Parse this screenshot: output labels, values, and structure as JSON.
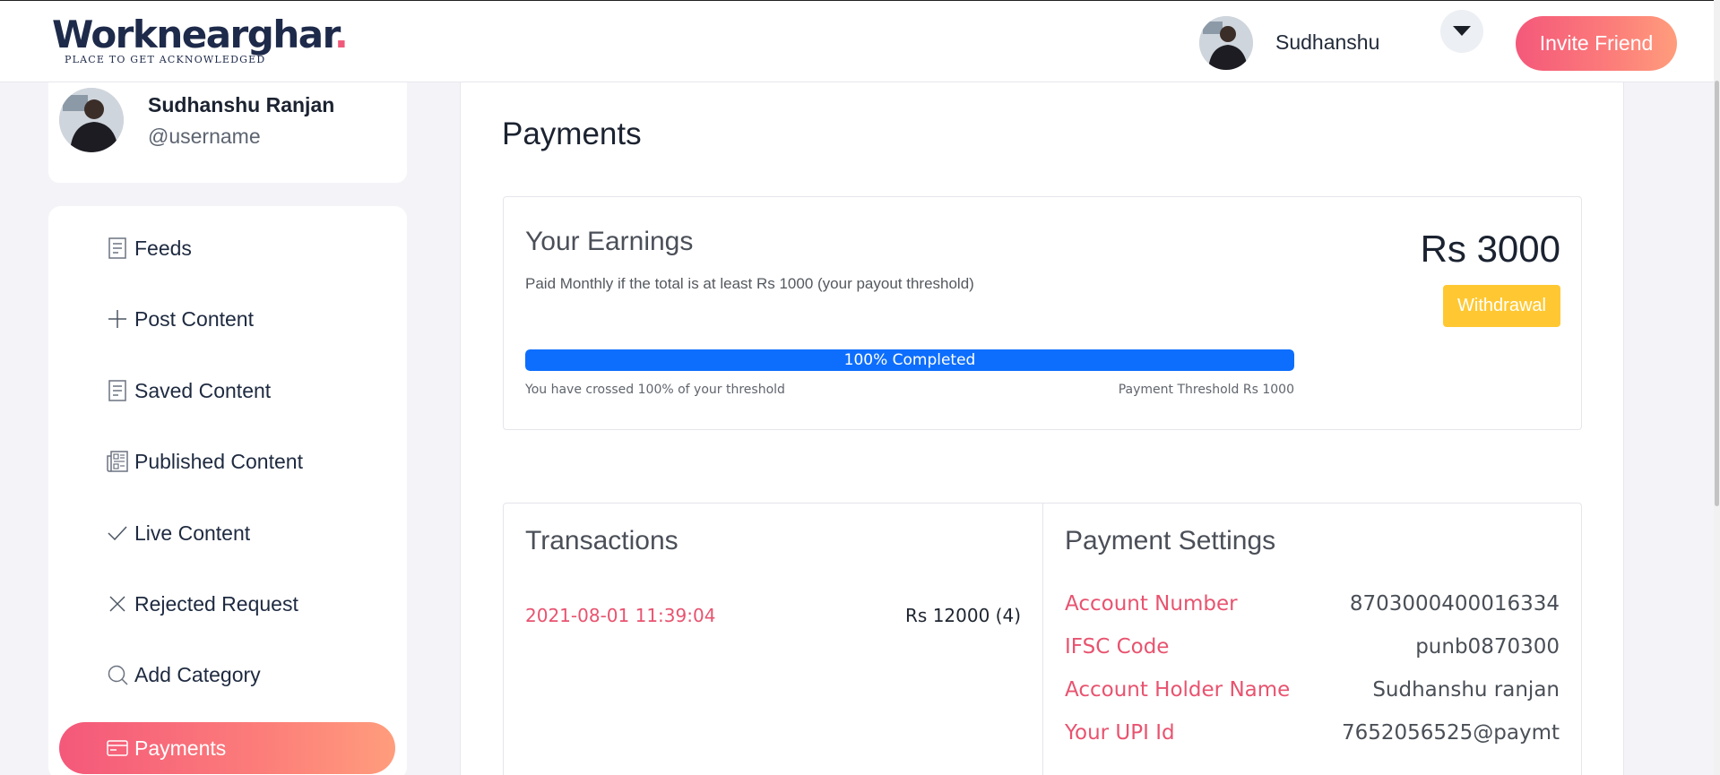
{
  "header": {
    "logo_text": "Worknearghar",
    "logo_dot": ".",
    "tagline": "PLACE TO GET ACKNOWLEDGED",
    "user_name": "Sudhanshu",
    "invite_label": "Invite Friend",
    "accent_gradient": [
      "#f4587a",
      "#ff9d7c"
    ]
  },
  "profile": {
    "name": "Sudhanshu Ranjan",
    "handle": "@username"
  },
  "sidebar": {
    "items": [
      {
        "label": "Feeds",
        "icon": "document-icon"
      },
      {
        "label": "Post Content",
        "icon": "plus-icon"
      },
      {
        "label": "Saved Content",
        "icon": "document-icon"
      },
      {
        "label": "Published Content",
        "icon": "newspaper-icon"
      },
      {
        "label": "Live Content",
        "icon": "check-icon"
      },
      {
        "label": "Rejected Request",
        "icon": "x-icon"
      },
      {
        "label": "Add Category",
        "icon": "search-icon"
      },
      {
        "label": "Payments",
        "icon": "credit-card-icon",
        "active": true
      }
    ]
  },
  "main": {
    "title": "Payments",
    "earnings": {
      "title": "Your Earnings",
      "subtitle": "Paid Monthly if the total is at least Rs 1000 (your payout threshold)",
      "amount": "Rs 3000",
      "withdraw_label": "Withdrawal",
      "withdraw_color": "#ffc832",
      "progress_label": "100% Completed",
      "progress_fraction": 1.0,
      "progress_color": "#0d6efd",
      "crossed_text": "You have crossed 100% of your threshold",
      "threshold_text": "Payment Threshold Rs 1000"
    },
    "transactions": {
      "title": "Transactions",
      "rows": [
        {
          "date": "2021-08-01 11:39:04",
          "amount": "Rs 12000 (4)"
        }
      ]
    },
    "payment_settings": {
      "title": "Payment Settings",
      "rows": [
        {
          "label": "Account Number",
          "value": "8703000400016334"
        },
        {
          "label": "IFSC Code",
          "value": "punb0870300"
        },
        {
          "label": "Account Holder Name",
          "value": "Sudhanshu ranjan"
        },
        {
          "label": "Your UPI Id",
          "value": "7652056525@paymt"
        }
      ]
    }
  }
}
